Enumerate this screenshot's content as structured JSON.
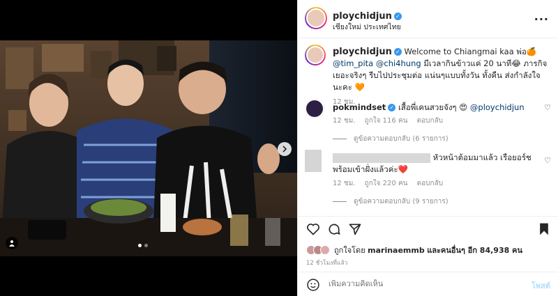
{
  "post": {
    "username": "ploychidjun",
    "location": "เชียงใหม่ ประเทศไทย",
    "more_label": "···",
    "next_icon": "chevron-right-icon",
    "tag_icon": "person-tag-icon"
  },
  "caption": {
    "username": "ploychidjun",
    "text_1": "Welcome to Chiangmai kaa พ่อ🍊",
    "mention_1": "@tim_pita",
    "mention_2": "@chi4hung",
    "text_2": "มีเวลากินข้าวแค่ 20 นาที😂 ภารกิจเยอะจริงๆ รีบไปประชุมต่อ แน่นๆแบบทั้งวัน ทั้งคืน ส่งกำลังใจนะคะ 🧡",
    "time": "12 ชม."
  },
  "comments": [
    {
      "username": "pokmindset",
      "text": "เสื้อพี่เคนสวยจังๆ 😍",
      "mention": "@ploychidjun",
      "time": "12 ชม.",
      "likes": "ถูกใจ 116 คน",
      "reply": "ตอบกลับ",
      "view_replies": "ดูข้อความตอบกลับ (6 รายการ)"
    },
    {
      "username": "",
      "text": "หัวหน้าต้อมมาแล้ว เรือยอร์ชพร้อมเข้าฝั่งแล้วค่ะ❤️",
      "time": "12 ชม.",
      "likes": "ถูกใจ 220 คน",
      "reply": "ตอบกลับ",
      "view_replies": "ดูข้อความตอบกลับ (9 รายการ)"
    }
  ],
  "likes": {
    "prefix": "ถูกใจโดย",
    "user": "marinaemmb",
    "suffix": "และคนอื่นๆ อีก 84,938 คน"
  },
  "timestamp": "12 ชั่วโมงที่แล้ว",
  "comment_box": {
    "placeholder": "เพิ่มความคิดเห็น",
    "post_label": "โพสต์",
    "emoji_icon": "emoji-icon"
  },
  "colors": {
    "link": "#00376b",
    "muted": "#8e8e8e",
    "verified": "#3897f0",
    "post_button": "#b2dffc"
  }
}
